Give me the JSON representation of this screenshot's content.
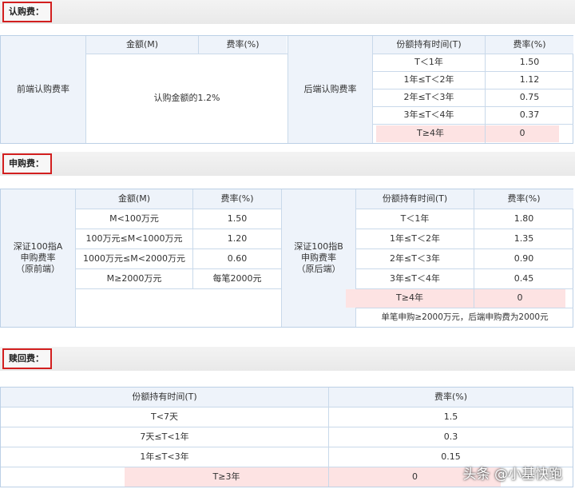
{
  "subscription": {
    "title": "认购费：",
    "front_label": "前端认购费率",
    "front_header_amount": "金额(M)",
    "front_header_rate": "费率(%)",
    "front_value": "认购金额的1.2%",
    "back_label": "后端认购费率",
    "back_header_period": "份额持有时间(T)",
    "back_header_rate": "费率(%)",
    "back_rows": [
      {
        "period": "T＜1年",
        "rate": "1.50"
      },
      {
        "period": "1年≤T＜2年",
        "rate": "1.12"
      },
      {
        "period": "2年≤T＜3年",
        "rate": "0.75"
      },
      {
        "period": "3年≤T＜4年",
        "rate": "0.37"
      },
      {
        "period": "T≥4年",
        "rate": "0"
      }
    ]
  },
  "purchase": {
    "title": "申购费：",
    "front_label": "深证100指A\n申购费率\n（原前端）",
    "front_header_amount": "金额(M)",
    "front_header_rate": "费率(%)",
    "front_rows": [
      {
        "amount": "M<100万元",
        "rate": "1.50"
      },
      {
        "amount": "100万元≤M<1000万元",
        "rate": "1.20"
      },
      {
        "amount": "1000万元≤M<2000万元",
        "rate": "0.60"
      },
      {
        "amount": "M≥2000万元",
        "rate": "每笔2000元"
      }
    ],
    "back_label": "深证100指B\n申购费率\n（原后端）",
    "back_header_period": "份额持有时间(T)",
    "back_header_rate": "费率(%)",
    "back_rows": [
      {
        "period": "T＜1年",
        "rate": "1.80"
      },
      {
        "period": "1年≤T＜2年",
        "rate": "1.35"
      },
      {
        "period": "2年≤T＜3年",
        "rate": "0.90"
      },
      {
        "period": "3年≤T＜4年",
        "rate": "0.45"
      },
      {
        "period": "T≥4年",
        "rate": "0"
      }
    ],
    "footnote": "单笔申购≥2000万元，后端申购费为2000元"
  },
  "redemption": {
    "title": "赎回费：",
    "header_period": "份额持有时间(T)",
    "header_rate": "费率(%)",
    "rows": [
      {
        "period": "T<7天",
        "rate": "1.5"
      },
      {
        "period": "7天≤T<1年",
        "rate": "0.3"
      },
      {
        "period": "1年≤T<3年",
        "rate": "0.15"
      },
      {
        "period": "T≥3年",
        "rate": "0"
      }
    ]
  },
  "watermark": "头条 @小基快跑",
  "colors": {
    "highlight": "#fde3e3",
    "header_bg": "#eef3fa",
    "border": "#bcd0e6",
    "title_box": "#d21f1f"
  }
}
